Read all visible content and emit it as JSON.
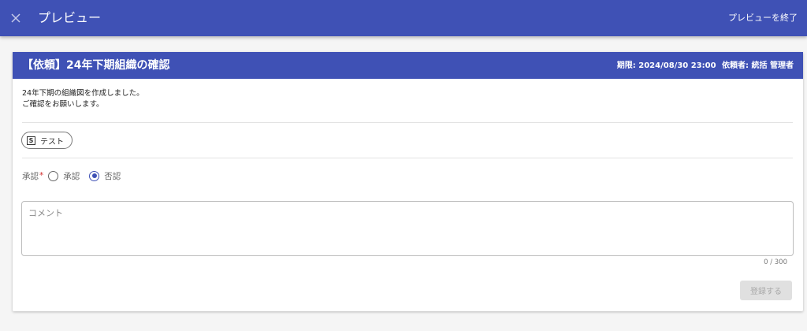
{
  "topbar": {
    "close_icon": "close-icon",
    "title": "プレビュー",
    "exit_label": "プレビューを終了"
  },
  "card": {
    "title": "【依頼】24年下期組織の確認",
    "deadline": "期限: 2024/08/30 23:00",
    "requester": "依頼者: 統括 管理者",
    "body_lines": [
      "24年下期の組織図を作成しました。",
      "ご確認をお願いします。"
    ],
    "attachment": {
      "icon_letter": "S",
      "label": "テスト"
    },
    "approval": {
      "label": "承認",
      "required_mark": "*",
      "options": [
        {
          "label": "承認",
          "checked": false
        },
        {
          "label": "否認",
          "checked": true
        }
      ]
    },
    "comment": {
      "placeholder": "コメント",
      "value": "",
      "counter": "0 / 300"
    },
    "submit_label": "登録する"
  },
  "colors": {
    "primary": "#3f51b5",
    "background": "#f5f5f5",
    "required": "#d32f2f"
  }
}
